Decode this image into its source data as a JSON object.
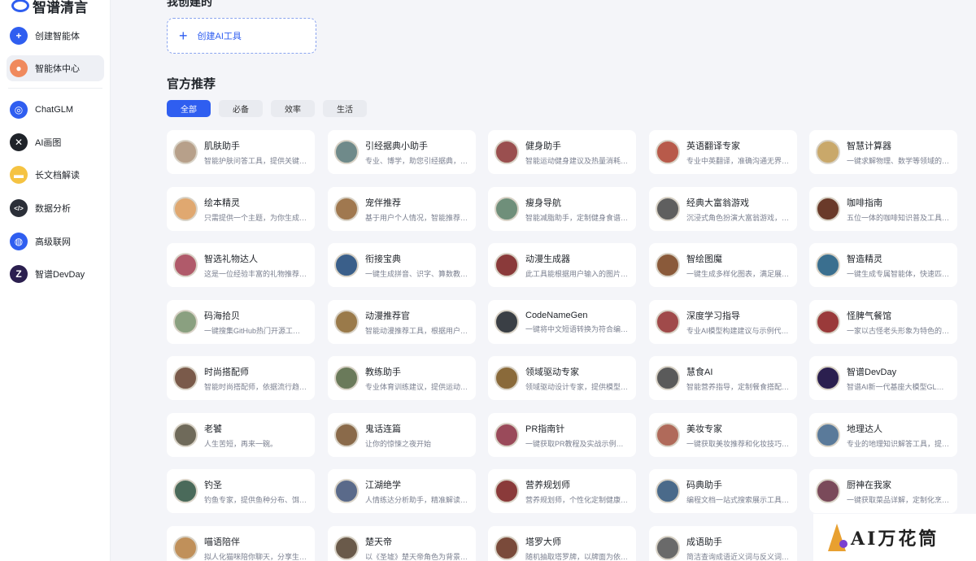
{
  "brand": {
    "name": "智谱清言"
  },
  "sidebar": {
    "items": [
      {
        "label": "创建智能体",
        "icon": "plus-icon",
        "color": "#2f5ef0",
        "glyph": "+"
      },
      {
        "label": "智能体中心",
        "icon": "agent-center-icon",
        "color": "#f08a5d",
        "glyph": "●"
      },
      {
        "label": "ChatGLM",
        "icon": "chatglm-icon",
        "color": "#2f5ef0",
        "glyph": "◎"
      },
      {
        "label": "AI画图",
        "icon": "ai-draw-icon",
        "color": "#1f2329",
        "glyph": "✕"
      },
      {
        "label": "长文档解读",
        "icon": "document-icon",
        "color": "#f5c342",
        "glyph": "▬"
      },
      {
        "label": "数据分析",
        "icon": "code-icon",
        "color": "#2b2f38",
        "glyph": "</>"
      },
      {
        "label": "高级联网",
        "icon": "globe-icon",
        "color": "#2f5ef0",
        "glyph": "◍"
      },
      {
        "label": "智谱DevDay",
        "icon": "devday-icon",
        "color": "#2b1f4f",
        "glyph": "Z"
      }
    ]
  },
  "main": {
    "my_created_title": "我创建的",
    "create_tool_label": "创建AI工具",
    "official_title": "官方推荐",
    "tabs": [
      "全部",
      "必备",
      "效率",
      "生活"
    ],
    "cards": [
      {
        "title": "肌肤助手",
        "desc": "智能护肤问答工具，提供关键…",
        "color": "#b7a08a"
      },
      {
        "title": "引经据典小助手",
        "desc": "专业、博学，助您引经据典，…",
        "color": "#6f8a8a"
      },
      {
        "title": "健身助手",
        "desc": "智能运动健身建议及热量消耗…",
        "color": "#9a4f4f"
      },
      {
        "title": "英语翻译专家",
        "desc": "专业中英翻译，准确沟通无界…",
        "color": "#b85a4a"
      },
      {
        "title": "智慧计算器",
        "desc": "一键求解物理、数学等领域的…",
        "color": "#c9a86a"
      },
      {
        "title": "绘本精灵",
        "desc": "只需提供一个主题，为你生成…",
        "color": "#e0a870"
      },
      {
        "title": "宠伴推荐",
        "desc": "基于用户个人情况，智能推荐…",
        "color": "#a0784f"
      },
      {
        "title": "瘦身导航",
        "desc": "智能减脂助手，定制健身食谱…",
        "color": "#6f8f7a"
      },
      {
        "title": "经典大富翁游戏",
        "desc": "沉浸式角色扮演大富翁游戏，…",
        "color": "#5f5f5f"
      },
      {
        "title": "咖啡指南",
        "desc": "五位一体的咖啡知识普及工具…",
        "color": "#6a3a2a"
      },
      {
        "title": "智选礼物达人",
        "desc": "这是一位经验丰富的礼物推荐…",
        "color": "#b05a6a"
      },
      {
        "title": "衔接宝典",
        "desc": "一键生成拼音、识字、算数教…",
        "color": "#3a5f8a"
      },
      {
        "title": "动漫生成器",
        "desc": "此工具能根据用户输入的图片…",
        "color": "#8a3a3a"
      },
      {
        "title": "智绘图魔",
        "desc": "一键生成多样化图表，满足展…",
        "color": "#8a5a3a"
      },
      {
        "title": "智造精灵",
        "desc": "一键生成专属智能体，快速匹…",
        "color": "#3a6f8f"
      },
      {
        "title": "码海拾贝",
        "desc": "一键搜集GitHub热门开源工…",
        "color": "#8aa080"
      },
      {
        "title": "动漫推荐官",
        "desc": "智能动漫推荐工具，根据用户…",
        "color": "#9a7a4a"
      },
      {
        "title": "CodeNameGen",
        "desc": "一键将中文短语转换为符合编…",
        "color": "#3a3f45"
      },
      {
        "title": "深度学习指导",
        "desc": "专业AI模型构建建议与示例代…",
        "color": "#a04a4a"
      },
      {
        "title": "怪脾气餐馆",
        "desc": "一家以古怪老头形象为特色的…",
        "color": "#9a3a3a"
      },
      {
        "title": "时尚搭配师",
        "desc": "智能时尚搭配师，依据流行趋…",
        "color": "#7a5a4a"
      },
      {
        "title": "教练助手",
        "desc": "专业体育训练建议，提供运动…",
        "color": "#6a7a5a"
      },
      {
        "title": "领域驱动专家",
        "desc": "领域驱动设计专家，提供模型…",
        "color": "#8a6a3a"
      },
      {
        "title": "慧食AI",
        "desc": "智能营养指导，定制餐食搭配…",
        "color": "#5a5a5a"
      },
      {
        "title": "智谱DevDay",
        "desc": "智谱AI新一代基座大模型GL…",
        "color": "#2b1f4f"
      },
      {
        "title": "老饕",
        "desc": "人生苦短，再来一碗。",
        "color": "#6f6a5a"
      },
      {
        "title": "鬼话连篇",
        "desc": "让你的惊悚之夜开始",
        "color": "#8a6a4a"
      },
      {
        "title": "PR指南针",
        "desc": "一键获取PR教程及实战示例…",
        "color": "#9a4a5a"
      },
      {
        "title": "美妆专家",
        "desc": "一键获取美妆推荐和化妆技巧…",
        "color": "#b06a5a"
      },
      {
        "title": "地理达人",
        "desc": "专业的地理知识解答工具，提…",
        "color": "#5a7a9a"
      },
      {
        "title": "钓圣",
        "desc": "钓鱼专家，提供鱼种分布、饵…",
        "color": "#4a6a5a"
      },
      {
        "title": "江湖绝学",
        "desc": "人情练达分析助手，精准解读…",
        "color": "#5a6a8a"
      },
      {
        "title": "营养规划师",
        "desc": "营养规划师，个性化定制健康…",
        "color": "#8a3a3a"
      },
      {
        "title": "码典助手",
        "desc": "编程文档一站式搜索展示工具…",
        "color": "#4a6a8a"
      },
      {
        "title": "厨神在我家",
        "desc": "一键获取菜品详解，定制化烹…",
        "color": "#7a4a5a"
      },
      {
        "title": "喵语陪伴",
        "desc": "拟人化猫咪陪你聊天，分享生…",
        "color": "#c0905a"
      },
      {
        "title": "楚天帝",
        "desc": "以《圣墟》楚天帝角色为背景…",
        "color": "#6a5a4a"
      },
      {
        "title": "塔罗大师",
        "desc": "随机抽取塔罗牌，以牌面为依…",
        "color": "#7a4a3a"
      },
      {
        "title": "成语助手",
        "desc": "简洁查询成语近义词与反义词…",
        "color": "#6a6a6a"
      }
    ]
  },
  "watermark": {
    "text": "AI万花筒"
  }
}
